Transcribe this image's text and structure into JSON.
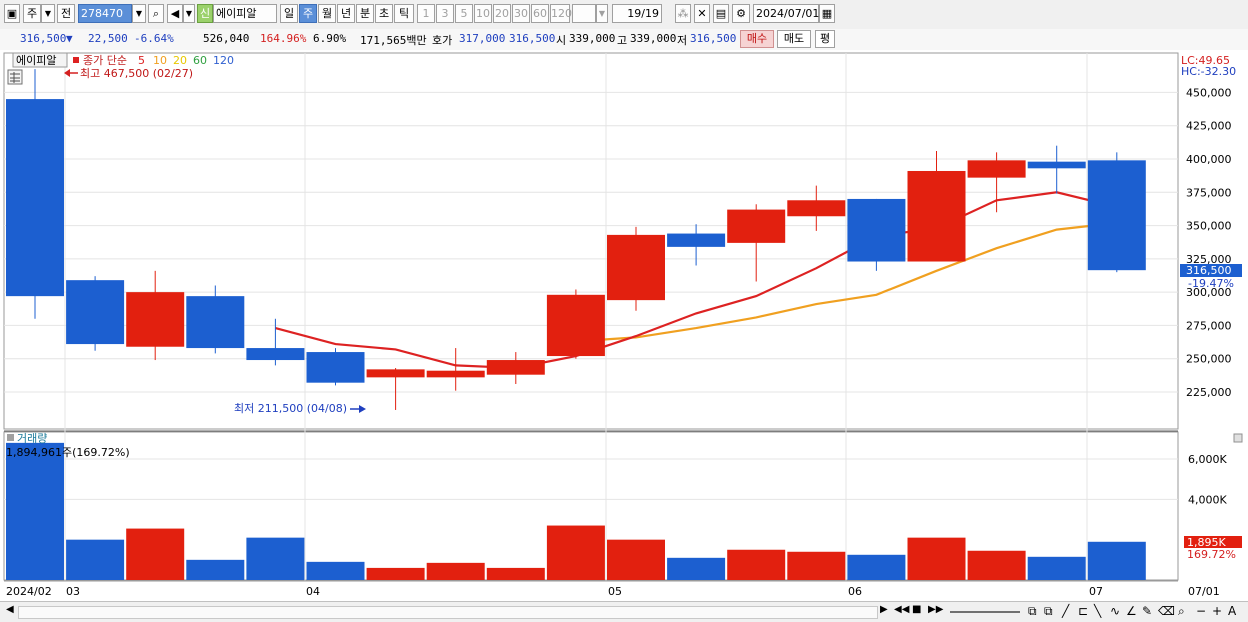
{
  "toolbar": {
    "period_label": "주",
    "prev_label": "전",
    "code": "278470",
    "sin_label": "신",
    "stock_name": "에이피알",
    "period_buttons": [
      "일",
      "주",
      "월",
      "년",
      "분",
      "초",
      "틱"
    ],
    "interval_buttons": [
      "1",
      "3",
      "5",
      "10",
      "20",
      "30",
      "60",
      "120"
    ],
    "count": "19",
    "count_total": "/19",
    "date": "2024/07/01"
  },
  "infobar": {
    "price": "316,500",
    "change_arrow": "▼",
    "change": "22,500",
    "change_pct": "-6.64%",
    "volume": "526,040",
    "volume_ratio": "164.96%",
    "turnover": "6.90%",
    "amount": "171,565백만",
    "bid_label": "호가",
    "ask_price": "317,000",
    "bid_price": "316,500",
    "open_label": "시",
    "open": "339,000",
    "high_label": "고",
    "high": "339,000",
    "low_label": "저",
    "low": "316,500",
    "buy_label": "매수",
    "sell_label": "매도",
    "avg_label": "평"
  },
  "legend": {
    "stock": "에이피알",
    "ma_label": "종가 단순",
    "ma_periods": [
      "5",
      "10",
      "20",
      "60",
      "120"
    ],
    "ma_colors": [
      "#dd2222",
      "#f0a020",
      "#e8c800",
      "#30a040",
      "#3060d0"
    ]
  },
  "annotations": {
    "high": "최고 467,500 (02/27)",
    "low": "최저 211,500 (04/08)",
    "lc": "LC:49.65",
    "hc": "HC:-32.30",
    "current_price": "316,500",
    "current_pct": "-19.47%",
    "volume_title": "거래량",
    "volume_info": "1,894,961주(169.72%)",
    "volume_current": "1,895K",
    "volume_current_pct": "169.72%"
  },
  "x_labels": [
    "2024/02",
    "03",
    "04",
    "05",
    "06",
    "07",
    "07/01"
  ],
  "chart_data": {
    "type": "candlestick",
    "price_ticks": [
      "450,000",
      "425,000",
      "400,000",
      "375,000",
      "350,000",
      "325,000",
      "300,000",
      "275,000",
      "250,000",
      "225,000"
    ],
    "volume_ticks": [
      "6,000K",
      "4,000K"
    ],
    "candles": [
      {
        "o": 445000,
        "h": 467500,
        "l": 280000,
        "c": 297000,
        "v": 6800
      },
      {
        "o": 309000,
        "h": 312000,
        "l": 256000,
        "c": 261000,
        "v": 2000
      },
      {
        "o": 259000,
        "h": 316000,
        "l": 249000,
        "c": 300000,
        "v": 2550
      },
      {
        "o": 297000,
        "h": 305000,
        "l": 254000,
        "c": 258000,
        "v": 1000
      },
      {
        "o": 258000,
        "h": 280000,
        "l": 245000,
        "c": 249000,
        "v": 2100
      },
      {
        "o": 255000,
        "h": 258000,
        "l": 230000,
        "c": 232000,
        "v": 900
      },
      {
        "o": 236000,
        "h": 243000,
        "l": 211500,
        "c": 242000,
        "v": 600
      },
      {
        "o": 236000,
        "h": 258000,
        "l": 226000,
        "c": 241000,
        "v": 850
      },
      {
        "o": 238000,
        "h": 255000,
        "l": 231000,
        "c": 249000,
        "v": 600
      },
      {
        "o": 252000,
        "h": 302000,
        "l": 250000,
        "c": 298000,
        "v": 2700
      },
      {
        "o": 294000,
        "h": 349000,
        "l": 286000,
        "c": 343000,
        "v": 2000
      },
      {
        "o": 344000,
        "h": 351000,
        "l": 320000,
        "c": 334000,
        "v": 1100
      },
      {
        "o": 337000,
        "h": 366000,
        "l": 308000,
        "c": 362000,
        "v": 1500
      },
      {
        "o": 357000,
        "h": 380000,
        "l": 346000,
        "c": 369000,
        "v": 1400
      },
      {
        "o": 370000,
        "h": 370000,
        "l": 316000,
        "c": 323000,
        "v": 1250
      },
      {
        "o": 323000,
        "h": 406000,
        "l": 323000,
        "c": 391000,
        "v": 2100
      },
      {
        "o": 386000,
        "h": 405000,
        "l": 360000,
        "c": 399000,
        "v": 1450
      },
      {
        "o": 398000,
        "h": 410000,
        "l": 374000,
        "c": 393000,
        "v": 1150
      },
      {
        "o": 399000,
        "h": 405000,
        "l": 315000,
        "c": 316500,
        "v": 1895
      }
    ],
    "ma5": [
      null,
      null,
      null,
      null,
      273000,
      261000,
      257000,
      245000,
      243000,
      252000,
      267000,
      284000,
      297000,
      318000,
      342000,
      348000,
      369000,
      375000,
      364000
    ],
    "ma10": [
      null,
      null,
      null,
      null,
      null,
      null,
      null,
      null,
      null,
      263000,
      266000,
      273000,
      281000,
      291000,
      298000,
      316000,
      333000,
      347000,
      352000
    ],
    "colors": {
      "up": "#e2200f",
      "down": "#1c5fd0",
      "ma5": "#dd2222",
      "ma10": "#f0a020"
    }
  }
}
